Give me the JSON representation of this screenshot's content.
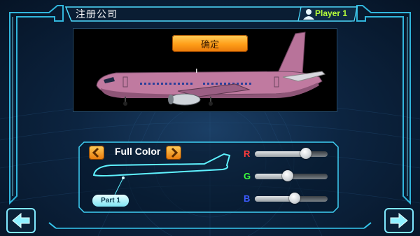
{
  "header": {
    "title": "注册公司",
    "player": "Player 1"
  },
  "preview": {
    "confirm_label": "确定"
  },
  "color_panel": {
    "mode_label": "Full Color",
    "part_label": "Part 1",
    "sliders": [
      {
        "channel": "R",
        "color": "#ff3b3b",
        "level": 0.7
      },
      {
        "channel": "G",
        "color": "#3cff3c",
        "level": 0.45
      },
      {
        "channel": "B",
        "color": "#3c5bff",
        "level": 0.55
      }
    ]
  },
  "icons": {
    "back": "left-arrow-icon",
    "next": "right-arrow-icon",
    "prev_color": "chevron-left-icon",
    "next_color": "chevron-right-icon",
    "player": "user-icon"
  },
  "colors": {
    "accent_cyan": "#39d6ff",
    "button_orange": "#ff9e18",
    "plane_body": "#c07aa0"
  }
}
